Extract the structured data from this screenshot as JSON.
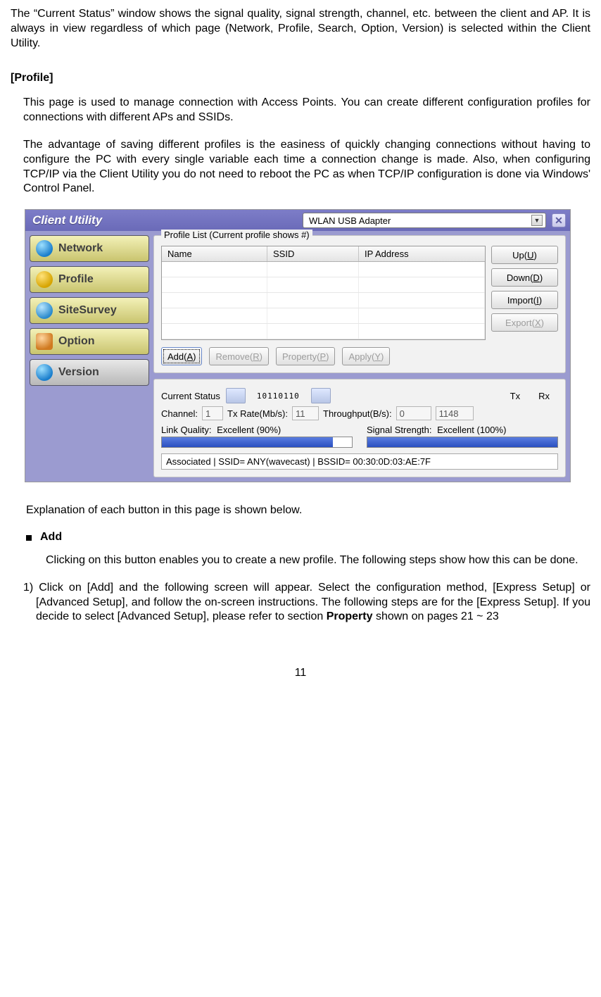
{
  "doc": {
    "intro": "The “Current Status” window shows the signal quality, signal strength, channel, etc. between the client and AP. It is always in view regardless of which page (Network, Profile, Search, Option, Version) is selected within the Client Utility.",
    "section_heading": "[Profile]",
    "p1": "This page is used to manage connection with Access Points. You can create different configuration profiles for connections with different APs and SSIDs.",
    "p2": "The advantage of saving different profiles is the easiness of quickly changing connections without having to configure the PC with every single variable each time a connection change is made. Also, when configuring TCP/IP via the Client Utility you do not need to reboot the PC as when TCP/IP configuration is done via Windows' Control Panel.",
    "explanation": "Explanation of each button in this page is shown below.",
    "bullet_add": "Add",
    "add_intro": "Clicking on this button enables you to create a new profile. The following steps show how this can be done.",
    "step1_prefix": "1) Click on [Add] and the following screen will appear. Select the configuration method, [Express Setup] or [Advanced Setup], and follow the on-screen instructions. The following steps are for the [Express Setup]. If you decide to select [Advanced Setup], please refer to section ",
    "step1_bold": "Property",
    "step1_suffix": " shown on pages 21 ~ 23",
    "page_number": "11"
  },
  "app": {
    "title": "Client Utility",
    "adapter": "WLAN USB Adapter",
    "nav": {
      "network": "Network",
      "profile": "Profile",
      "sitesurvey": "SiteSurvey",
      "option": "Option",
      "version": "Version"
    },
    "profile_panel": {
      "legend": "Profile List (Current profile shows #)",
      "col_name": "Name",
      "col_ssid": "SSID",
      "col_ip": "IP Address",
      "btn_up_pre": "Up(",
      "btn_up_u": "U",
      "btn_up_post": ")",
      "btn_down_pre": "Down(",
      "btn_down_u": "D",
      "btn_down_post": ")",
      "btn_import_pre": "Import(",
      "btn_import_u": "I",
      "btn_import_post": ")",
      "btn_export_pre": "Export(",
      "btn_export_u": "X",
      "btn_export_post": ")",
      "btn_add_pre": "Add(",
      "btn_add_u": "A",
      "btn_add_post": ")",
      "btn_remove_pre": "Remove(",
      "btn_remove_u": "R",
      "btn_remove_post": ")",
      "btn_property_pre": "Property(",
      "btn_property_u": "P",
      "btn_property_post": ")",
      "btn_apply_pre": "Apply(",
      "btn_apply_u": "Y",
      "btn_apply_post": ")"
    },
    "status": {
      "legend": "Current Status",
      "digits": "10110110",
      "channel_label": "Channel:",
      "channel_value": "1",
      "txrate_label": "Tx Rate(Mb/s):",
      "txrate_value": "11",
      "throughput_label": "Throughput(B/s):",
      "tx_label": "Tx",
      "rx_label": "Rx",
      "tx_value": "0",
      "rx_value": "1148",
      "link_quality_label": "Link Quality:",
      "link_quality_value": "Excellent (90%)",
      "signal_strength_label": "Signal Strength:",
      "signal_strength_value": "Excellent (100%)",
      "assoc": "Associated | SSID= ANY(wavecast) | BSSID= 00:30:0D:03:AE:7F"
    }
  }
}
